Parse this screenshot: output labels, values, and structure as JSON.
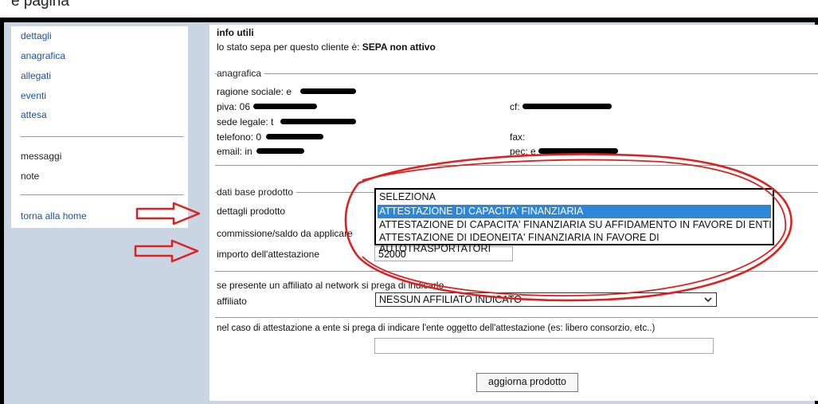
{
  "top_text": "e pagina",
  "sidebar": {
    "items": [
      {
        "label": "dettagli"
      },
      {
        "label": "anagrafica"
      },
      {
        "label": "allegati"
      },
      {
        "label": "eventi"
      },
      {
        "label": "attesa"
      },
      {
        "label": "messaggi"
      },
      {
        "label": "note"
      },
      {
        "label": "torna alla home"
      }
    ]
  },
  "info": {
    "title": "info utili",
    "sepa_prefix": "lo stato sepa per questo cliente è: ",
    "sepa_status": "SEPA non attivo"
  },
  "anagrafica": {
    "legend": "anagrafica",
    "ragione_sociale": "ragione sociale: e",
    "piva": "piva: 06",
    "sede_legale": "sede legale: t",
    "telefono": "telefono: 0",
    "email": "email: in",
    "cf": "cf:",
    "fax": "fax:",
    "pec": "pec: e"
  },
  "prodotto": {
    "legend": "dati base prodotto",
    "dettagli_label": "dettagli prodotto",
    "commissione_label": "commissione/saldo da applicare",
    "importo_label": "importo dell'attestazione",
    "importo_value": "52000",
    "options": [
      "SELEZIONA",
      "ATTESTAZIONE DI CAPACITA' FINANZIARIA",
      "ATTESTAZIONE DI CAPACITA' FINANZIARIA SU AFFIDAMENTO IN FAVORE DI ENTI",
      "ATTESTAZIONE DI IDEONEITA' FINANZIARIA IN FAVORE DI AUTOTRASPORTATORI"
    ]
  },
  "affiliato": {
    "note": "se presente un affiliato al network si prega di indicarlo",
    "label": "affiliato",
    "selected": "NESSUN AFFILIATO INDICATO"
  },
  "ente": {
    "note": "nel caso di attestazione a ente si prega di indicare l'ente oggetto dell'attestazione (es: libero consorzio, etc..)"
  },
  "update_button": "aggiorna prodotto",
  "colors": {
    "link": "#1e4fa3",
    "highlight": "#2e86d8",
    "annotation": "#e02020",
    "background": "#c9d5e2"
  }
}
